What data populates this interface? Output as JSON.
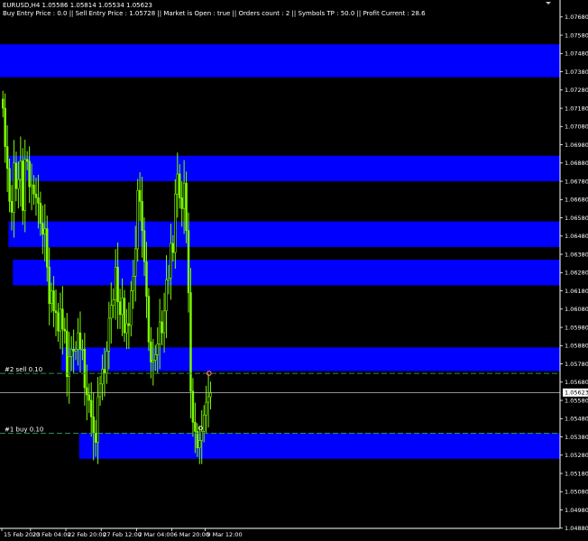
{
  "window": {
    "symbol_line": "EURUSD,H4  1.05586 1.05814 1.05534 1.05623",
    "info_line": "Buy Entry Price : 0.0 || Sell Entry Price : 1.05728 || Market is Open : true || Orders count : 2 || Symbols TP : 50.0 ||   Profit Current   : 28.6"
  },
  "colors": {
    "background": "#000000",
    "zone": "#0000ff",
    "candle": "#7cfc00",
    "order_line": "#2e8b57",
    "current_price_line": "#c0c0c0",
    "axis": "#ffffff",
    "close_marker": "#ff6a6a"
  },
  "chart_data": {
    "type": "candlestick",
    "symbol": "EURUSD",
    "timeframe": "H4",
    "ohlc_last": {
      "open": 1.05586,
      "high": 1.05814,
      "low": 1.05534,
      "close": 1.05623
    },
    "current_price": "1.05623",
    "y_ticks": [
      "1.07680",
      "1.07580",
      "1.07480",
      "1.07380",
      "1.07280",
      "1.07180",
      "1.07080",
      "1.06980",
      "1.06880",
      "1.06780",
      "1.06680",
      "1.06580",
      "1.06480",
      "1.06380",
      "1.06280",
      "1.06180",
      "1.06080",
      "1.05980",
      "1.05880",
      "1.05780",
      "1.05680",
      "1.05580",
      "1.05480",
      "1.05380",
      "1.05280",
      "1.05180",
      "1.05080",
      "1.04980",
      "1.04880"
    ],
    "ylim": [
      1.0484,
      1.0775
    ],
    "x_labels": [
      {
        "label": "15 Feb 2023",
        "bar": 0
      },
      {
        "label": "20 Feb 04:00",
        "bar": 13
      },
      {
        "label": "22 Feb 20:00",
        "bar": 29
      },
      {
        "label": "27 Feb 12:00",
        "bar": 45
      },
      {
        "label": "2 Mar 04:00",
        "bar": 61
      },
      {
        "label": "6 Mar 20:00",
        "bar": 77
      },
      {
        "label": "9 Mar 12:00",
        "bar": 92
      }
    ],
    "bar_count": 95,
    "zones": [
      {
        "from_bar": -1,
        "top": 1.0753,
        "bottom": 1.0735
      },
      {
        "from_bar": 3,
        "top": 1.0692,
        "bottom": 1.0678
      },
      {
        "from_bar": 3,
        "top": 1.0656,
        "bottom": 1.0642
      },
      {
        "from_bar": 5,
        "top": 1.0635,
        "bottom": 1.0621
      },
      {
        "from_bar": 27,
        "top": 1.0587,
        "bottom": 1.0574
      },
      {
        "from_bar": 35,
        "top": 1.054,
        "bottom": 1.0526
      }
    ],
    "orders": [
      {
        "label": "#2 sell 0.10",
        "price": 1.05728
      },
      {
        "label": "#1 buy 0.10",
        "price": 1.054
      }
    ],
    "close": [
      1.0718,
      1.0697,
      1.0685,
      1.0667,
      1.0661,
      1.0688,
      1.0674,
      1.0679,
      1.0689,
      1.0662,
      1.069,
      1.0689,
      1.0675,
      1.0676,
      1.0671,
      1.0669,
      1.0666,
      1.0655,
      1.0649,
      1.0652,
      1.0631,
      1.0611,
      1.0618,
      1.0607,
      1.0606,
      1.0596,
      1.0608,
      1.0597,
      1.0596,
      1.0571,
      1.0582,
      1.0586,
      1.0585,
      1.0586,
      1.0595,
      1.0586,
      1.0586,
      1.0565,
      1.0561,
      1.0558,
      1.0549,
      1.054,
      1.0535,
      1.056,
      1.0567,
      1.0575,
      1.0573,
      1.0585,
      1.0603,
      1.061,
      1.0613,
      1.0631,
      1.0612,
      1.0605,
      1.0614,
      1.0595,
      1.06,
      1.0599,
      1.0618,
      1.0626,
      1.0641,
      1.0673,
      1.0667,
      1.0651,
      1.0634,
      1.0615,
      1.059,
      1.0579,
      1.058,
      1.0583,
      1.0589,
      1.0601,
      1.0595,
      1.0607,
      1.0624,
      1.0625,
      1.0644,
      1.0639,
      1.0671,
      1.0682,
      1.0669,
      1.0663,
      1.0677,
      1.0651,
      1.0617,
      1.0563,
      1.0546,
      1.0541,
      1.0532,
      1.0536,
      1.0541,
      1.055,
      1.0557,
      1.056,
      1.0562
    ]
  }
}
